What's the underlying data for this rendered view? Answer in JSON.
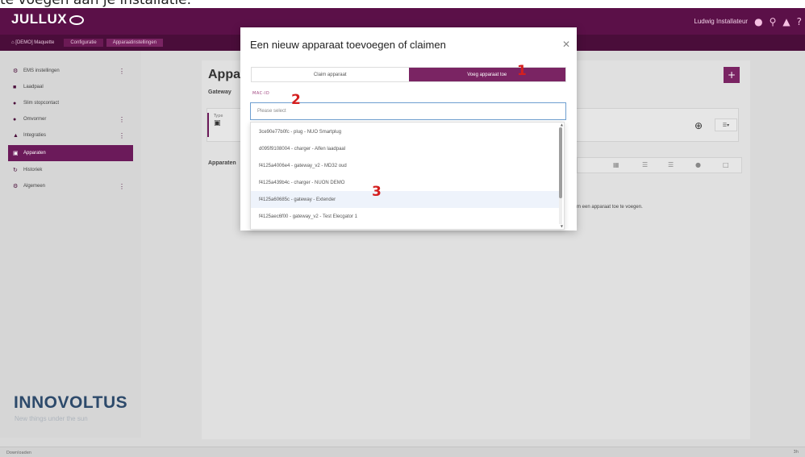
{
  "caption": "te voegen aan je installatie.",
  "app": {
    "logo": "JULLUX",
    "user": "Ludwig Installateur"
  },
  "breadcrumbs": [
    "[DEMO] Maquette",
    "Configuratie",
    "Apparaatinstellingen"
  ],
  "sidebar": {
    "items": [
      {
        "label": "EMS instellingen",
        "more": "⋮"
      },
      {
        "label": "Laadpaal",
        "more": ""
      },
      {
        "label": "Slim stopcontact",
        "more": ""
      },
      {
        "label": "Omvormer",
        "more": "⋮"
      },
      {
        "label": "Integraties",
        "more": "⋮"
      },
      {
        "label": "Apparaten",
        "more": ""
      },
      {
        "label": "Historiek",
        "more": ""
      },
      {
        "label": "Algemeen",
        "more": "⋮"
      }
    ],
    "brand": "INNOVOLTUS",
    "brand_sub": "New things under the sun"
  },
  "main": {
    "title": "Appa",
    "gateway_label": "Gateway",
    "gateway_type_label": "Type",
    "devices_title": "Apparaten",
    "empty_text": "pna om een apparaat toe te voegen."
  },
  "bottom": {
    "left": "Downloaden",
    "right": "3h"
  },
  "modal": {
    "title": "Een nieuw apparaat toevoegen of claimen",
    "tabs": [
      "Claim apparaat",
      "Voeg apparaat toe"
    ],
    "field_label": "MAC-ID",
    "placeholder": "Please select",
    "options": [
      "3ce90e77b0fc - plug - NUO Smartplug",
      "d095f9108004 - charger - Alfen laadpaal",
      "f4125a4006e4 - gateway_v2 - MD32 oud",
      "f4125a439b4c - charger - NUON DEMO",
      "f4125a60685c - gateway - Extender",
      "f4125aec6f00 - gateway_v2 - Test Elecgator 1"
    ]
  },
  "markers": [
    "1",
    "2",
    "3"
  ],
  "colors": {
    "primary": "#7a2463",
    "topbar": "#5b1048",
    "marker": "#d41f1f"
  }
}
